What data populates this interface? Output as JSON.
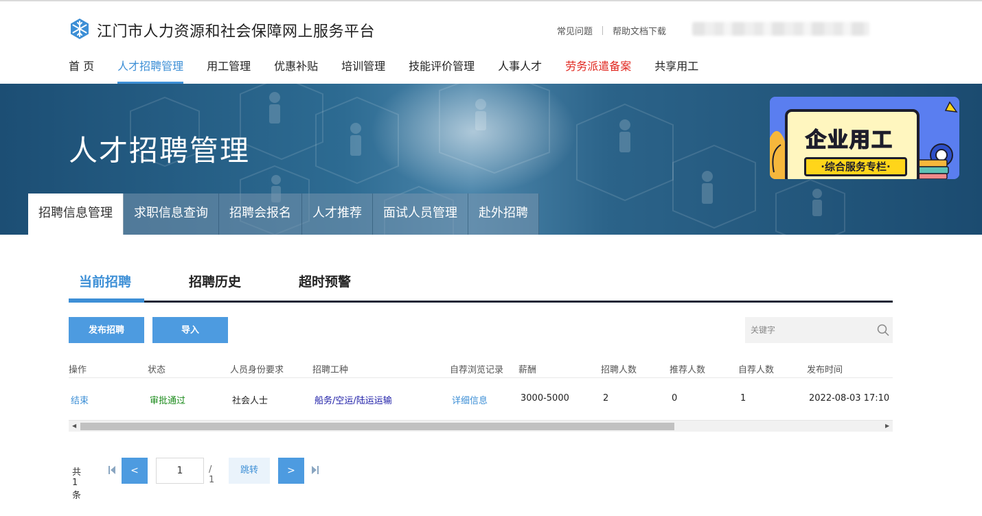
{
  "header": {
    "site_title": "江门市人力资源和社会保障网上服务平台",
    "links": [
      "常见问题",
      "帮助文档下载"
    ]
  },
  "mainnav": [
    {
      "label": "首 页"
    },
    {
      "label": "人才招聘管理",
      "active": true
    },
    {
      "label": "用工管理"
    },
    {
      "label": "优惠补贴"
    },
    {
      "label": "培训管理"
    },
    {
      "label": "技能评价管理"
    },
    {
      "label": "人事人才"
    },
    {
      "label": "劳务派遣备案",
      "highlight": "#e0261e"
    },
    {
      "label": "共享用工"
    }
  ],
  "banner": {
    "title": "人才招聘管理",
    "promo_title": "企业用工",
    "promo_subtitle": "·综合服务专栏·"
  },
  "subnav": [
    "招聘信息管理",
    "求职信息查询",
    "招聘会报名",
    "人才推荐",
    "面试人员管理",
    "赴外招聘"
  ],
  "content_tabs": [
    "当前招聘",
    "招聘历史",
    "超时预警"
  ],
  "actions": {
    "publish": "发布招聘",
    "import": "导入"
  },
  "search": {
    "placeholder": "关键字",
    "value": ""
  },
  "table": {
    "headers": [
      "操作",
      "状态",
      "人员身份要求",
      "招聘工种",
      "自荐浏览记录",
      "薪酬",
      "招聘人数",
      "推荐人数",
      "自荐人数",
      "发布时间"
    ],
    "rows": [
      [
        "结束",
        "审批通过",
        "社会人士",
        "船务/空运/陆运运输",
        "详细信息",
        "3000-5000",
        "2",
        "0",
        "1",
        "2022-08-03 17:10"
      ]
    ]
  },
  "pager": {
    "total": "共1条",
    "prev": "<",
    "page": "1",
    "pages": "/ 1",
    "jump": "跳转",
    "next": ">"
  },
  "colors": {
    "accent": "#3d8fd6",
    "button": "#4d9be0",
    "warn": "#e0261e",
    "approved": "#1a8a1a"
  }
}
